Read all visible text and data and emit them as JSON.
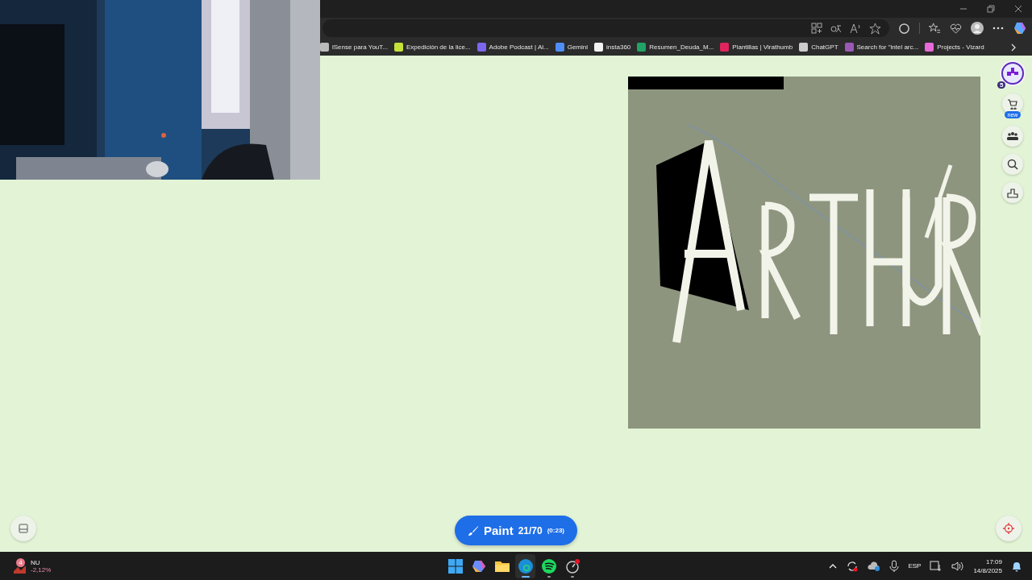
{
  "bookmarks": [
    {
      "label": "lSense para YouT..."
    },
    {
      "label": "Expedición de la lice..."
    },
    {
      "label": "Adobe Podcast | Al..."
    },
    {
      "label": "Gemini"
    },
    {
      "label": "insta360"
    },
    {
      "label": "Resumen_Deuda_M..."
    },
    {
      "label": "Plantillas | Virathumb"
    },
    {
      "label": "ChatGPT"
    },
    {
      "label": "Search for \"intel arc..."
    },
    {
      "label": "Projects - Vizard"
    }
  ],
  "map": {
    "profile_badge": "5",
    "shop_badge": "new",
    "paint_button": {
      "label": "Paint",
      "count": "21/70",
      "timer": "(0:23)"
    }
  },
  "taskbar": {
    "stock": {
      "badge": "4",
      "ticker": "NU",
      "change": "-2,12%"
    },
    "apps": [
      {
        "selected": false,
        "running": false
      },
      {
        "selected": false,
        "running": false
      },
      {
        "selected": false,
        "running": false
      },
      {
        "selected": true,
        "running": true
      },
      {
        "selected": false,
        "running": true
      },
      {
        "selected": false,
        "running": true
      }
    ],
    "language": "ESP",
    "time": "17:09",
    "date": "14/8/2025"
  }
}
